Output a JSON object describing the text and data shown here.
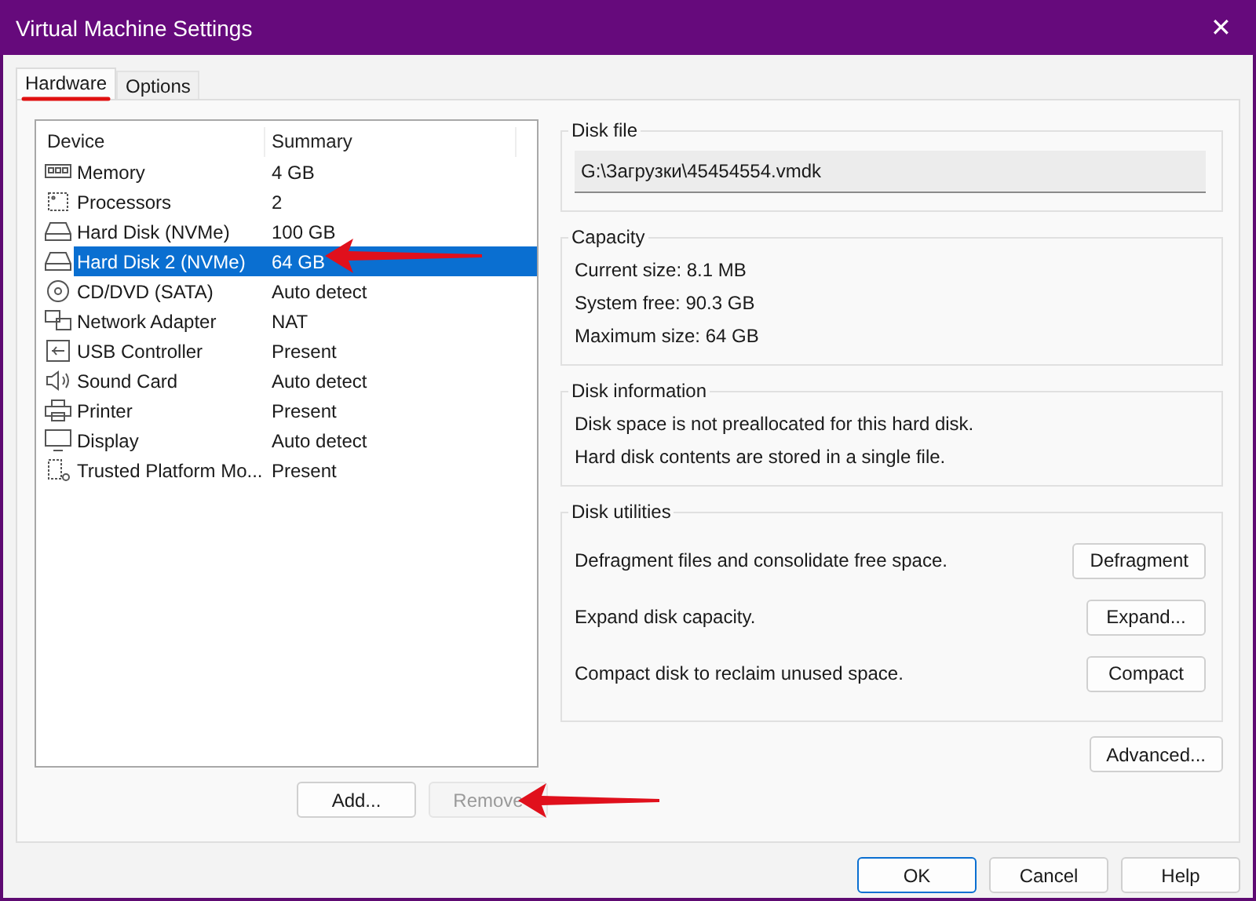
{
  "window": {
    "title": "Virtual Machine Settings",
    "close": "✕"
  },
  "tabs": [
    {
      "label": "Hardware",
      "selected": true
    },
    {
      "label": "Options",
      "selected": false
    }
  ],
  "device_table": {
    "columns": [
      "Device",
      "Summary"
    ],
    "rows": [
      {
        "kind": "memory",
        "device": "Memory",
        "summary": "4 GB",
        "selected": false
      },
      {
        "kind": "cpu",
        "device": "Processors",
        "summary": "2",
        "selected": false
      },
      {
        "kind": "disk",
        "device": "Hard Disk (NVMe)",
        "summary": "100 GB",
        "selected": false
      },
      {
        "kind": "disk",
        "device": "Hard Disk 2 (NVMe)",
        "summary": "64 GB",
        "selected": true
      },
      {
        "kind": "cd",
        "device": "CD/DVD (SATA)",
        "summary": "Auto detect",
        "selected": false
      },
      {
        "kind": "network",
        "device": "Network Adapter",
        "summary": "NAT",
        "selected": false
      },
      {
        "kind": "usb",
        "device": "USB Controller",
        "summary": "Present",
        "selected": false
      },
      {
        "kind": "sound",
        "device": "Sound Card",
        "summary": "Auto detect",
        "selected": false
      },
      {
        "kind": "printer",
        "device": "Printer",
        "summary": "Present",
        "selected": false
      },
      {
        "kind": "display",
        "device": "Display",
        "summary": "Auto detect",
        "selected": false
      },
      {
        "kind": "tpm",
        "device": "Trusted Platform Mo...",
        "summary": "Present",
        "selected": false
      }
    ]
  },
  "list_buttons": [
    {
      "label": "Add...",
      "disabled": false
    },
    {
      "label": "Remove",
      "disabled": true
    }
  ],
  "disk_file": {
    "title": "Disk file",
    "value": "G:\\Загрузки\\45454554.vmdk"
  },
  "capacity": {
    "title": "Capacity",
    "lines": [
      "Current size: 8.1 MB",
      "System free: 90.3 GB",
      "Maximum size: 64 GB"
    ]
  },
  "disk_information": {
    "title": "Disk information",
    "lines": [
      "Disk space is not preallocated for this hard disk.",
      "Hard disk contents are stored in a single file."
    ]
  },
  "disk_utilities": {
    "title": "Disk utilities",
    "items": [
      {
        "text": "Defragment files and consolidate free space.",
        "button": "Defragment"
      },
      {
        "text": "Expand disk capacity.",
        "button": "Expand..."
      },
      {
        "text": "Compact disk to reclaim unused space.",
        "button": "Compact"
      }
    ]
  },
  "advanced_button": "Advanced...",
  "dialog_buttons": [
    {
      "label": "OK",
      "default": true
    },
    {
      "label": "Cancel",
      "default": false
    },
    {
      "label": "Help",
      "default": false
    }
  ]
}
